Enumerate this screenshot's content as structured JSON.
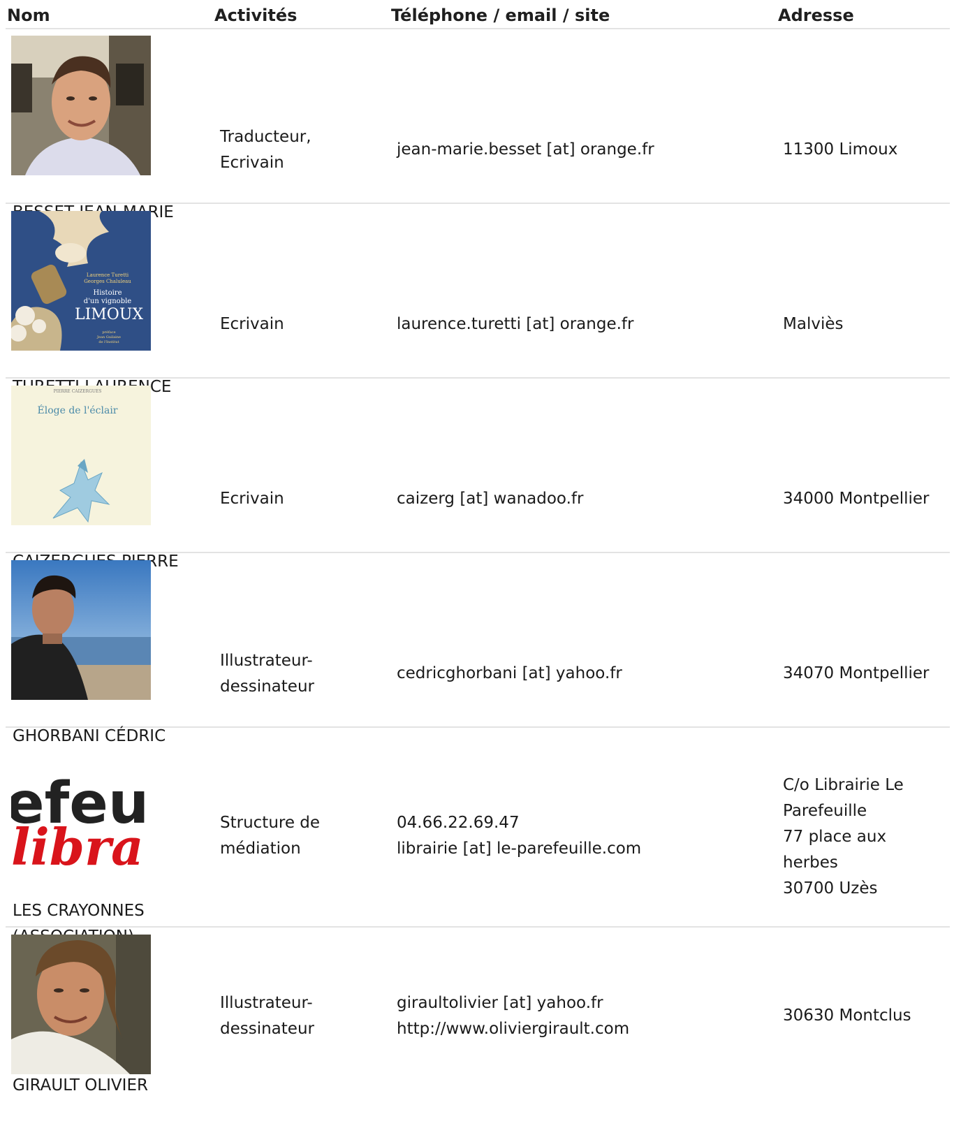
{
  "header": {
    "name": "Nom",
    "activities": "Activités",
    "contact": "Téléphone / email / site",
    "address": "Adresse"
  },
  "rows": [
    {
      "name": "BESSET JEAN-MARIE",
      "activity": [
        "Traducteur,",
        "Ecrivain"
      ],
      "contact": [
        "jean-marie.besset [at] orange.fr"
      ],
      "address": [
        "11300 Limoux"
      ]
    },
    {
      "name": "TURETTI LAURENCE",
      "activity": [
        "Ecrivain"
      ],
      "contact": [
        "laurence.turetti [at] orange.fr"
      ],
      "address": [
        "Malviès"
      ],
      "book": {
        "authors": [
          "Laurence Turetti",
          "Georges Chaluleau"
        ],
        "title_lines": [
          "Histoire",
          "d'un vignoble"
        ],
        "title_main": "LIMOUX",
        "preface": [
          "préface",
          "Jean Guilaine",
          "de l'Institut"
        ]
      }
    },
    {
      "name": "CAIZERGUES PIERRE",
      "activity": [
        "Ecrivain"
      ],
      "contact": [
        "caizerg [at] wanadoo.fr"
      ],
      "address": [
        "34000 Montpellier"
      ],
      "book": {
        "author": "PIERRE CAIZERGUES",
        "title": "Éloge de l'éclair"
      }
    },
    {
      "name": "GHORBANI CÉDRIC",
      "activity": [
        "Illustrateur-",
        "dessinateur"
      ],
      "contact": [
        "cedricghorbani [at] yahoo.fr"
      ],
      "address": [
        "34070 Montpellier"
      ]
    },
    {
      "name": [
        "LES CRAYONNES",
        "(ASSOCIATION)"
      ],
      "activity": [
        "Structure de",
        "médiation"
      ],
      "contact": [
        "04.66.22.69.47",
        "librairie [at] le-parefeuille.com"
      ],
      "address": [
        "C/o Librairie Le",
        "Parefeuille",
        "77 place aux",
        "herbes",
        "30700 Uzès"
      ],
      "logo": {
        "top": "efeu",
        "bottom": "libra"
      }
    },
    {
      "name": "GIRAULT OLIVIER",
      "activity": [
        "Illustrateur-",
        "dessinateur"
      ],
      "contact": [
        "giraultolivier [at] yahoo.fr",
        "http://www.oliviergirault.com"
      ],
      "address": [
        "30630 Montclus"
      ]
    }
  ],
  "colors": {
    "divider": "#e3e3e3",
    "text": "#1a1a1a",
    "logo_red": "#d9141b"
  }
}
